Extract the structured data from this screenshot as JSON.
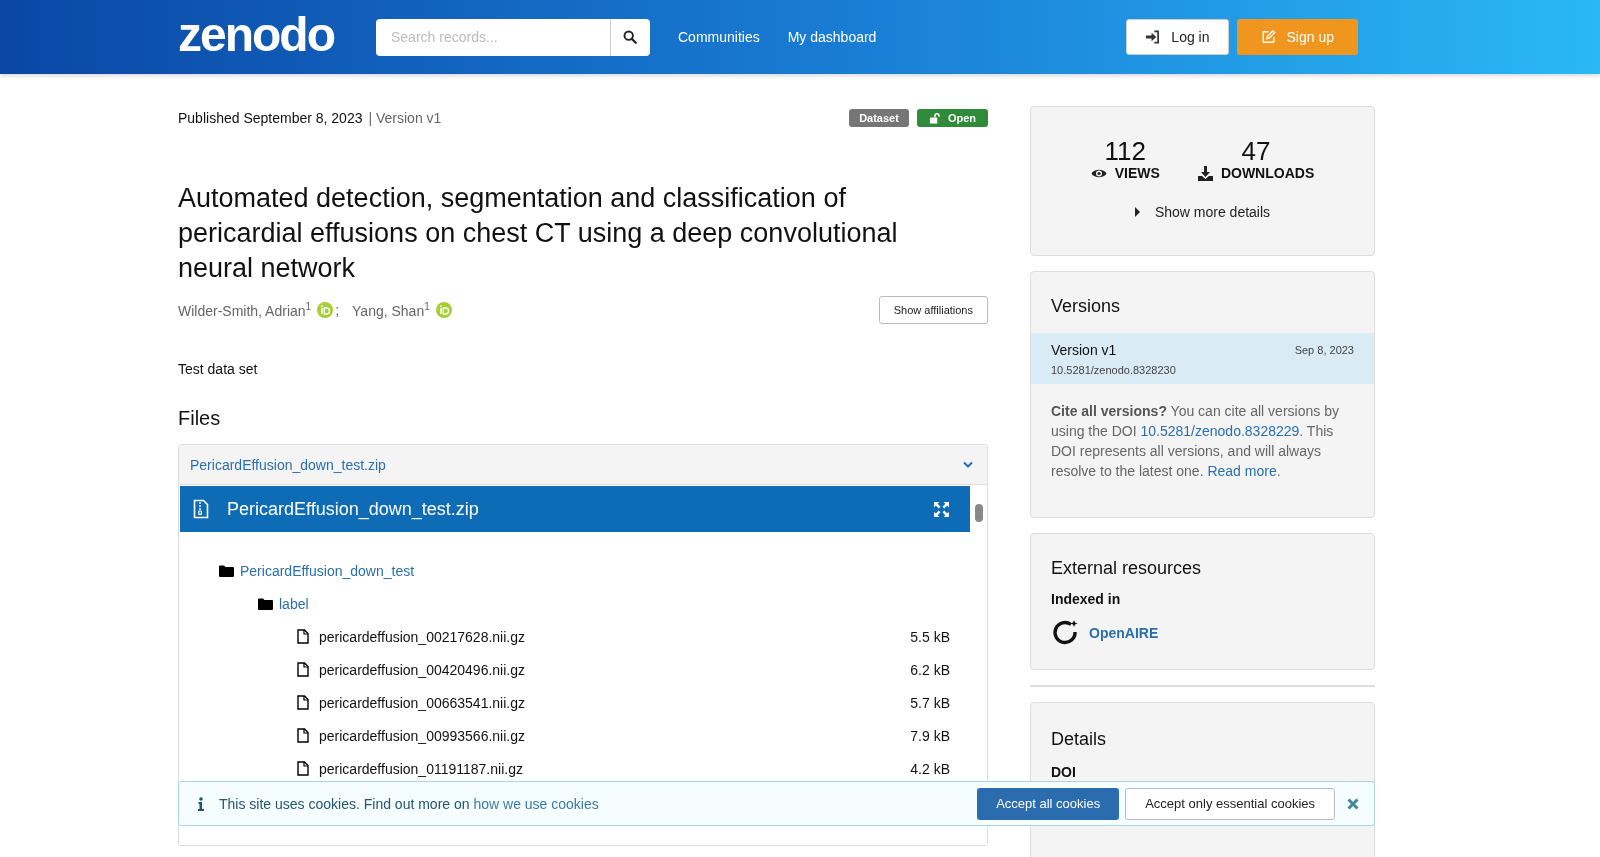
{
  "header": {
    "logo": "zenodo",
    "search": {
      "placeholder": "Search records..."
    },
    "nav": [
      "Communities",
      "My dashboard"
    ],
    "buttons": [
      {
        "label": "Log in",
        "kind": "login"
      },
      {
        "label": "Sign up",
        "kind": "signup"
      }
    ]
  },
  "record": {
    "published": "Published September 8, 2023",
    "version": "| Version v1",
    "badges": [
      {
        "label": "Dataset",
        "kind": "type"
      },
      {
        "label": "Open",
        "kind": "access"
      }
    ],
    "title": "Automated detection, segmentation and classification of pericardial effusions on chest CT using a deep convolutional neural network",
    "creators": [
      {
        "name": "Wilder-Smith, Adrian$^{1}$",
        "separator": ";"
      },
      {
        "name": "Yang, Shan$^{1}$"
      }
    ],
    "affiliations_button": "Show affiliations",
    "description": "Test data set"
  },
  "files": {
    "heading": "Files",
    "archive": "PericardEffusion_down_test.zip",
    "preview_title": "PericardEffusion_down_test.zip",
    "tree": [
      {
        "name": "PericardEffusion_down_test",
        "kind": "folder",
        "children": [
          {
            "name": "label",
            "kind": "folder",
            "children": [
              {
                "name": "pericardeffusion_00217628.nii.gz",
                "kind": "file",
                "size": "5.5 kB"
              },
              {
                "name": "pericardeffusion_00420496.nii.gz",
                "kind": "file",
                "size": "6.2 kB"
              },
              {
                "name": "pericardeffusion_00663541.nii.gz",
                "kind": "file",
                "size": "5.7 kB"
              },
              {
                "name": "pericardeffusion_00993566.nii.gz",
                "kind": "file",
                "size": "7.9 kB"
              },
              {
                "name": "pericardeffusion_01191187.nii.gz",
                "kind": "file",
                "size": "4.2 kB"
              }
            ]
          }
        ]
      }
    ]
  },
  "sidebar": {
    "stats": [
      {
        "value": "112",
        "label": "VIEWS",
        "kind": "views"
      },
      {
        "value": "47",
        "label": "DOWNLOADS",
        "kind": "downloads"
      }
    ],
    "show_more": "Show more details",
    "versions": {
      "heading": "Versions",
      "items": [
        {
          "label": "Version v1",
          "date": "Sep 8, 2023",
          "doi": "10.5281/zenodo.8328230",
          "selected": true
        }
      ],
      "cite_bold": "Cite all versions?",
      "cite_text": "You can cite all versions by using the DOI",
      "cite_doi": "10.5281/zenodo.8328229",
      "cite_text2": ". This DOI represents all versions, and will always resolve to the latest one.",
      "read_more": "Read more",
      "end": "."
    },
    "external": {
      "heading": "External resources",
      "indexed_label": "Indexed in",
      "indexes": [
        "OpenAIRE"
      ]
    },
    "details": {
      "heading": "Details",
      "fields": [
        "DOI"
      ]
    }
  },
  "cookie": {
    "text": "This site uses cookies. Find out more on",
    "link": "how we use cookies",
    "accept_all": "Accept all cookies",
    "accept_essential": "Accept only essential cookies"
  }
}
